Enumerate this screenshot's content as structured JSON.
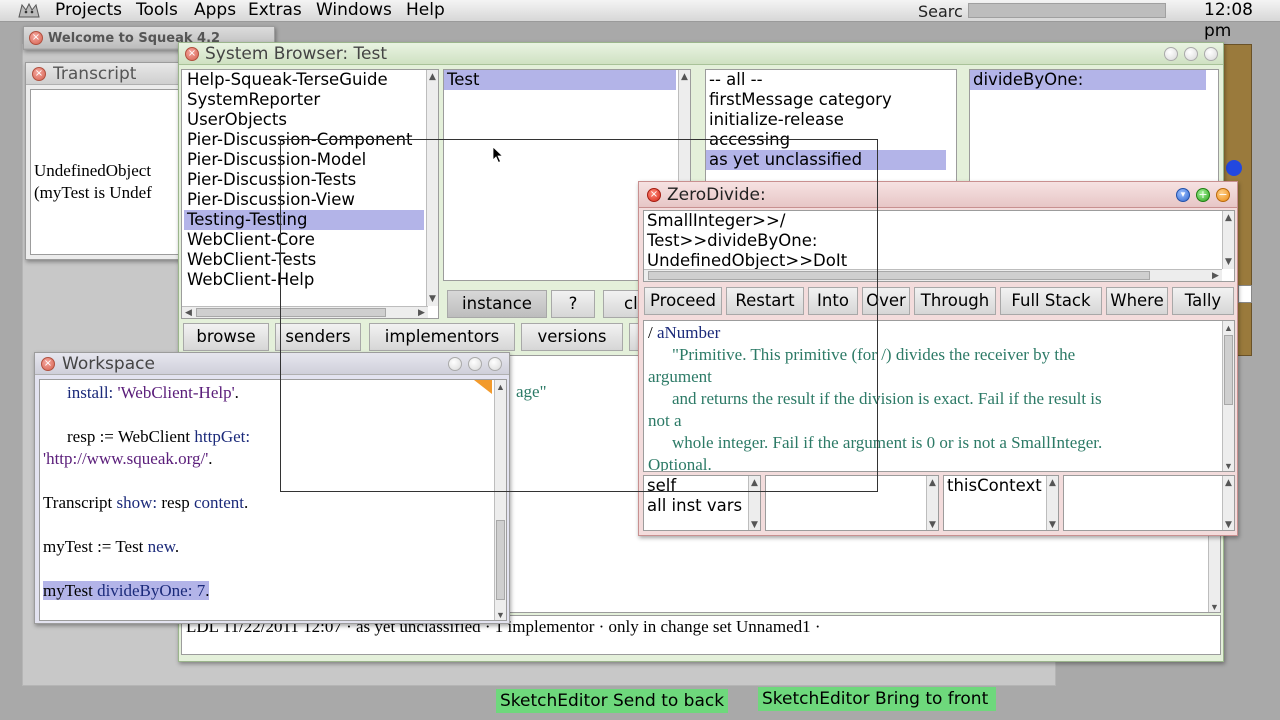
{
  "menubar": {
    "items": [
      "Projects",
      "Tools",
      "Apps",
      "Extras",
      "Windows",
      "Help"
    ],
    "search_label": "Searc",
    "clock": "12:08 pm"
  },
  "welcome": {
    "title": "Welcome to Squeak 4.2"
  },
  "transcript": {
    "title": "Transcript",
    "lines": [
      "UndefinedObject",
      "(myTest is Undef"
    ]
  },
  "browser": {
    "title": "System Browser: Test",
    "packages": [
      "Help-Squeak-TerseGuide",
      "SystemReporter",
      "UserObjects",
      "Pier-Discussion-Component",
      "Pier-Discussion-Model",
      "Pier-Discussion-Tests",
      "Pier-Discussion-View",
      "Testing-Testing",
      "WebClient-Core",
      "WebClient-Tests",
      "WebClient-Help"
    ],
    "classes": [
      "Test"
    ],
    "categories": [
      "-- all --",
      "firstMessage category",
      "initialize-release",
      "accessing",
      "as yet unclassified"
    ],
    "methods": [
      "divideByOne:"
    ],
    "toggle_buttons": [
      "instance",
      "?",
      "class"
    ],
    "tool_buttons": [
      "browse",
      "senders",
      "implementors",
      "versions"
    ],
    "code_fragment": "age\"",
    "status": "LDL 11/22/2011 12:07 · as yet unclassified · 1 implementor · only in change set Unnamed1  ·"
  },
  "zerodivide": {
    "title": "ZeroDivide:",
    "stack": [
      "SmallInteger>>/",
      "Test>>divideByOne:",
      "UndefinedObject>>DoIt"
    ],
    "buttons": [
      "Proceed",
      "Restart",
      "Into",
      "Over",
      "Through",
      "Full Stack",
      "Where",
      "Tally"
    ],
    "code_selector": "/",
    "code_arg": "aNumber",
    "code_lines": [
      "\"Primitive. This primitive (for /) divides the receiver by the",
      "argument",
      "and returns the result if the division is exact. Fail if the result is",
      "not a",
      "whole integer. Fail if the argument is 0 or is not a SmallInteger.",
      "Optional."
    ],
    "receiver_fields": [
      "self",
      "all inst vars"
    ],
    "context_fields": [
      "thisContext"
    ]
  },
  "workspace": {
    "title": "Workspace",
    "l1a": "install: ",
    "l1b": "'WebClient-Help'",
    "l1c": ".",
    "l2a": "resp ",
    "l2b": ":= ",
    "l2c": "WebClient ",
    "l2d": "httpGet:",
    "l3a": "'http://www.squeak.org/'",
    "l3b": ".",
    "l4a": "Transcript ",
    "l4b": "show: ",
    "l4c": "resp ",
    "l4d": "content",
    "l4e": ".",
    "l5a": "myTest ",
    "l5b": ":= ",
    "l5c": "Test ",
    "l5d": "new",
    "l5e": ".",
    "l6a": "myTest ",
    "l6b": "divideByOne: ",
    "l6c": "7",
    "l6d": "."
  },
  "sketch": {
    "back": "SketchEditor Send to back",
    "front": "SketchEditor Bring to front"
  },
  "colors": {
    "selection": "#b3b4e8",
    "sketch": "#6ed87c",
    "error_border": "#c89090"
  }
}
